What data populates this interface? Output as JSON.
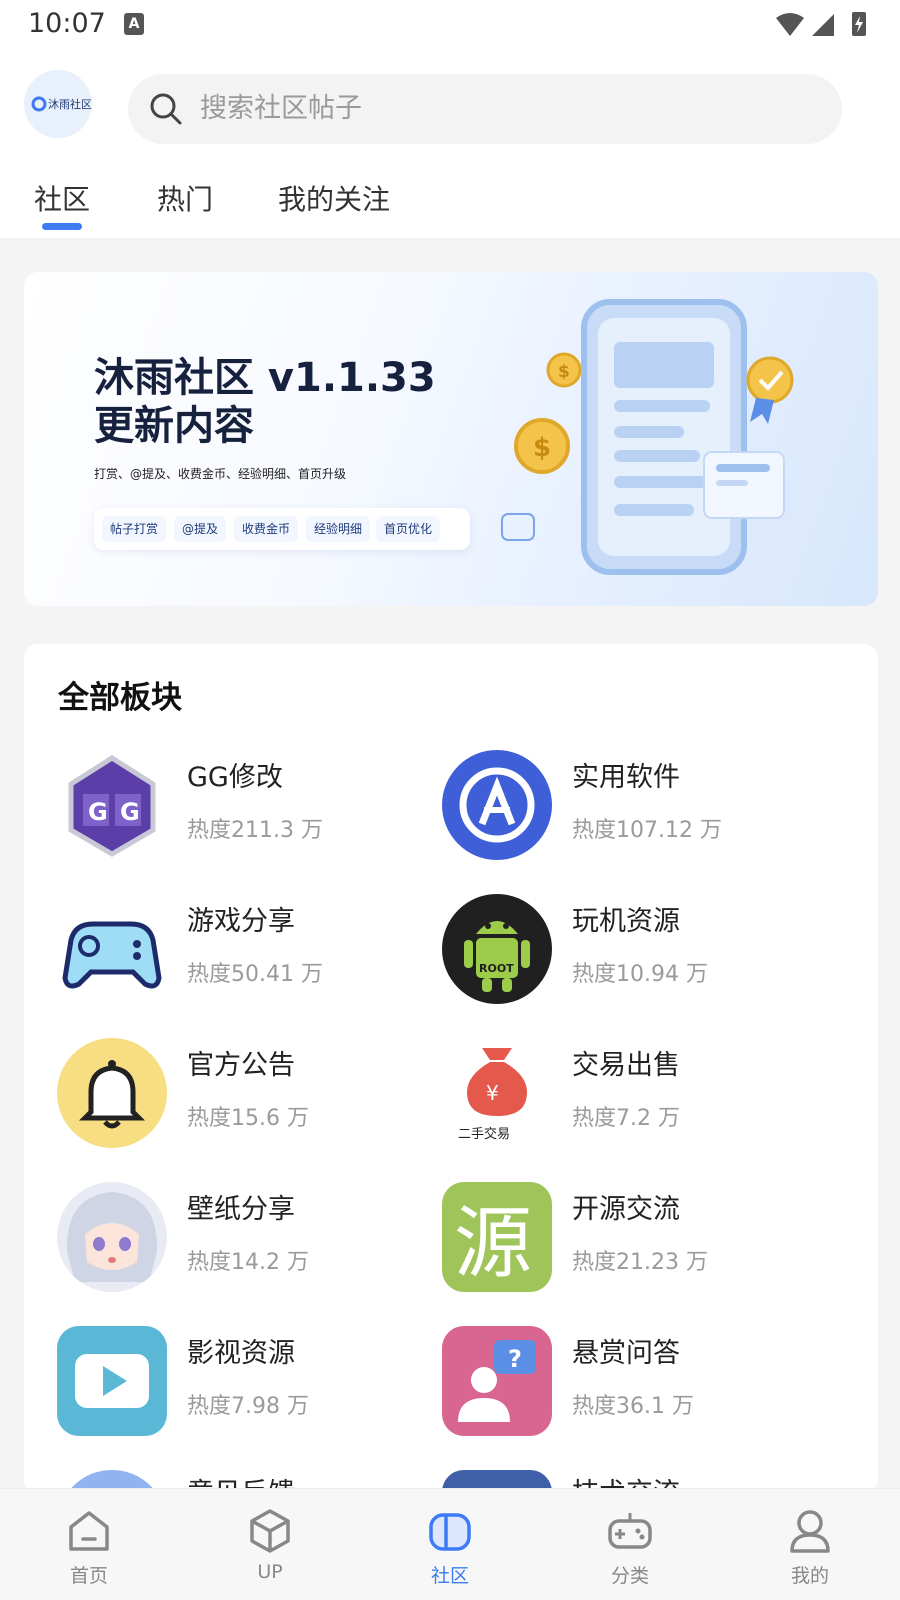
{
  "status_bar": {
    "time": "10:07",
    "notification_icon": "A"
  },
  "header": {
    "logo_text": "沐雨社区",
    "search_placeholder": "搜索社区帖子"
  },
  "tabs": [
    {
      "label": "社区",
      "active": true
    },
    {
      "label": "热门",
      "active": false
    },
    {
      "label": "我的关注",
      "active": false
    }
  ],
  "banner": {
    "title_line1": "沐雨社区 v1.1.33",
    "title_line2": "更新内容",
    "subtitle": "打赏、@提及、收费金币、经验明细、首页升级",
    "tags": [
      "帖子打赏",
      "@提及",
      "收费金币",
      "经验明细",
      "首页优化"
    ]
  },
  "boards": {
    "title": "全部板块",
    "items": [
      {
        "name": "GG修改",
        "heat": "热度211.3 万",
        "icon": "gg-icon"
      },
      {
        "name": "实用软件",
        "heat": "热度107.12 万",
        "icon": "app-store-icon"
      },
      {
        "name": "游戏分享",
        "heat": "热度50.41 万",
        "icon": "gamepad-icon"
      },
      {
        "name": "玩机资源",
        "heat": "热度10.94 万",
        "icon": "android-root-icon",
        "icon_text": "ROOT"
      },
      {
        "name": "官方公告",
        "heat": "热度15.6 万",
        "icon": "bell-icon"
      },
      {
        "name": "交易出售",
        "heat": "热度7.2 万",
        "icon": "money-bag-icon",
        "icon_text": "二手交易"
      },
      {
        "name": "壁纸分享",
        "heat": "热度14.2 万",
        "icon": "anime-girl-icon"
      },
      {
        "name": "开源交流",
        "heat": "热度21.23 万",
        "icon": "source-char-icon",
        "icon_text": "源"
      },
      {
        "name": "影视资源",
        "heat": "热度7.98 万",
        "icon": "play-icon"
      },
      {
        "name": "悬赏问答",
        "heat": "热度36.1 万",
        "icon": "question-user-icon"
      },
      {
        "name": "意见反馈",
        "heat": "",
        "icon": "feedback-icon"
      },
      {
        "name": "技术交流",
        "heat": "",
        "icon": "tech-icon"
      }
    ]
  },
  "bottom_nav": [
    {
      "label": "首页",
      "icon": "home-icon",
      "active": false
    },
    {
      "label": "UP",
      "icon": "cube-icon",
      "active": false
    },
    {
      "label": "社区",
      "icon": "community-icon",
      "active": true
    },
    {
      "label": "分类",
      "icon": "gamepad-icon",
      "active": false
    },
    {
      "label": "我的",
      "icon": "user-icon",
      "active": false
    }
  ],
  "colors": {
    "accent": "#3d7bf5",
    "background": "#f4f4f5"
  }
}
